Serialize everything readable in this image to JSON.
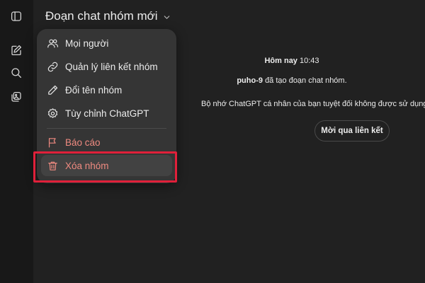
{
  "sidebar": {
    "items": [
      {
        "icon": "sidebar-toggle-icon"
      },
      {
        "icon": "new-chat-icon"
      },
      {
        "icon": "search-icon"
      },
      {
        "icon": "library-icon"
      }
    ]
  },
  "header": {
    "title": "Đoạn chat nhóm mới"
  },
  "menu": {
    "items": [
      {
        "label": "Mọi người",
        "icon": "people-icon"
      },
      {
        "label": "Quản lý liên kết nhóm",
        "icon": "link-icon"
      },
      {
        "label": "Đổi tên nhóm",
        "icon": "pencil-icon"
      },
      {
        "label": "Tùy chỉnh ChatGPT",
        "icon": "gear-icon"
      },
      {
        "label": "Báo cáo",
        "icon": "flag-icon"
      },
      {
        "label": "Xóa nhóm",
        "icon": "trash-icon"
      }
    ]
  },
  "chat": {
    "time_label": "Hôm nay",
    "time_value": "10:43",
    "creator": "puho-9",
    "created_text": "đã tạo đoạn chat nhóm.",
    "memory_notice": "Bộ nhớ ChatGPT cá nhân của bạn tuyệt đối không được sử dụng t",
    "join_button": "Mời qua liên kết"
  },
  "colors": {
    "background": "#212121",
    "sidebar": "#181818",
    "menu": "#353535",
    "danger": "#ef8a80",
    "highlight": "#e0203a"
  }
}
